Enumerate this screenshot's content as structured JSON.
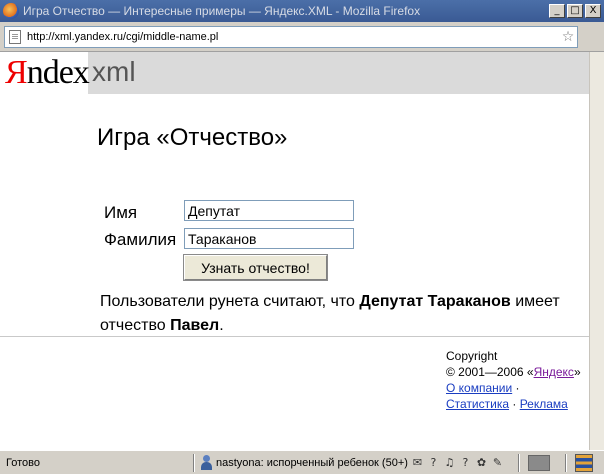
{
  "window": {
    "title": "Игра Отчество — Интересные примеры — Яндекс.XML - Mozilla Firefox",
    "buttons": {
      "minimize": "_",
      "maximize": "□",
      "close": "X"
    }
  },
  "address_bar": {
    "url": "http://xml.yandex.ru/cgi/middle-name.pl",
    "bookmark_icon": "star-icon"
  },
  "header": {
    "logo_first_letter": "Я",
    "logo_rest": "ndex",
    "product": "xml"
  },
  "page": {
    "title": "Игра «Отчество»",
    "form": {
      "first_name_label": "Имя",
      "first_name_value": "Депутат",
      "last_name_label": "Фамилия",
      "last_name_value": "Тараканов",
      "submit_label": "Узнать отчество!"
    },
    "result": {
      "prefix": "Пользователи рунета считают, что ",
      "full_name": "Депутат Тараканов",
      "middle": " имеет отчество ",
      "patronymic": "Павел",
      "suffix": "."
    }
  },
  "footer": {
    "copyright_label": "Copyright",
    "years": "© 2001—2006 «",
    "yandex_link": "Яндекс",
    "years_end": "»",
    "about_link": "О компании",
    "sep1": " ·",
    "stats_link": "Статистика",
    "sep2": " · ",
    "ads_link": "Реклама"
  },
  "status_bar": {
    "status": "Готово",
    "user_text": "nastyona: испорченный ребенок (50+)",
    "help_mark": "?"
  }
}
